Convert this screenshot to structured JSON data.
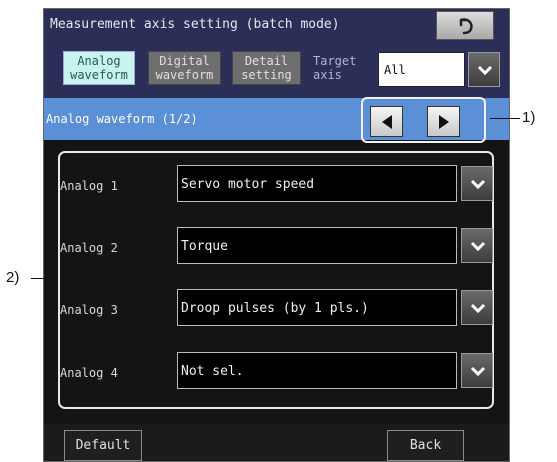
{
  "window": {
    "title": "Measurement axis setting (batch mode)"
  },
  "tabs": [
    {
      "label": "Analog\nwaveform",
      "active": true
    },
    {
      "label": "Digital\nwaveform",
      "active": false
    },
    {
      "label": "Detail\nsetting",
      "active": false
    }
  ],
  "target_axis": {
    "label": "Target\naxis",
    "value": "All"
  },
  "section": {
    "label": "Analog waveform (1/2)"
  },
  "analog_rows": [
    {
      "label": "Analog 1",
      "value": "Servo motor speed"
    },
    {
      "label": "Analog 2",
      "value": "Torque"
    },
    {
      "label": "Analog 3",
      "value": "Droop pulses (by 1 pls.)"
    },
    {
      "label": "Analog 4",
      "value": "Not sel."
    }
  ],
  "footer": {
    "default_label": "Default",
    "back_label": "Back"
  },
  "callouts": {
    "pager": "1)",
    "list": "2)"
  },
  "icons": {
    "back": "return-arrow-icon",
    "dropdown": "chevron-down-icon",
    "prev": "triangle-left-icon",
    "next": "triangle-right-icon"
  },
  "colors": {
    "title_bar": "#2b2f58",
    "active_tab": "#c8f3ef",
    "section_bar": "#5b8fd6",
    "screen_bg": "#141414"
  }
}
